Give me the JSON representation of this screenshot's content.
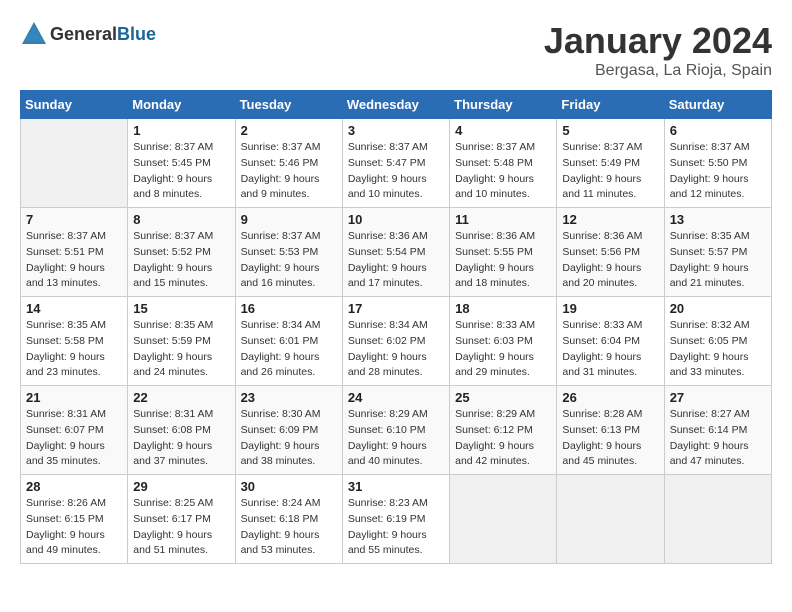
{
  "header": {
    "logo_general": "General",
    "logo_blue": "Blue",
    "title": "January 2024",
    "subtitle": "Bergasa, La Rioja, Spain"
  },
  "calendar": {
    "days_of_week": [
      "Sunday",
      "Monday",
      "Tuesday",
      "Wednesday",
      "Thursday",
      "Friday",
      "Saturday"
    ],
    "weeks": [
      [
        {
          "day": "",
          "detail": ""
        },
        {
          "day": "1",
          "detail": "Sunrise: 8:37 AM\nSunset: 5:45 PM\nDaylight: 9 hours\nand 8 minutes."
        },
        {
          "day": "2",
          "detail": "Sunrise: 8:37 AM\nSunset: 5:46 PM\nDaylight: 9 hours\nand 9 minutes."
        },
        {
          "day": "3",
          "detail": "Sunrise: 8:37 AM\nSunset: 5:47 PM\nDaylight: 9 hours\nand 10 minutes."
        },
        {
          "day": "4",
          "detail": "Sunrise: 8:37 AM\nSunset: 5:48 PM\nDaylight: 9 hours\nand 10 minutes."
        },
        {
          "day": "5",
          "detail": "Sunrise: 8:37 AM\nSunset: 5:49 PM\nDaylight: 9 hours\nand 11 minutes."
        },
        {
          "day": "6",
          "detail": "Sunrise: 8:37 AM\nSunset: 5:50 PM\nDaylight: 9 hours\nand 12 minutes."
        }
      ],
      [
        {
          "day": "7",
          "detail": "Sunrise: 8:37 AM\nSunset: 5:51 PM\nDaylight: 9 hours\nand 13 minutes."
        },
        {
          "day": "8",
          "detail": "Sunrise: 8:37 AM\nSunset: 5:52 PM\nDaylight: 9 hours\nand 15 minutes."
        },
        {
          "day": "9",
          "detail": "Sunrise: 8:37 AM\nSunset: 5:53 PM\nDaylight: 9 hours\nand 16 minutes."
        },
        {
          "day": "10",
          "detail": "Sunrise: 8:36 AM\nSunset: 5:54 PM\nDaylight: 9 hours\nand 17 minutes."
        },
        {
          "day": "11",
          "detail": "Sunrise: 8:36 AM\nSunset: 5:55 PM\nDaylight: 9 hours\nand 18 minutes."
        },
        {
          "day": "12",
          "detail": "Sunrise: 8:36 AM\nSunset: 5:56 PM\nDaylight: 9 hours\nand 20 minutes."
        },
        {
          "day": "13",
          "detail": "Sunrise: 8:35 AM\nSunset: 5:57 PM\nDaylight: 9 hours\nand 21 minutes."
        }
      ],
      [
        {
          "day": "14",
          "detail": "Sunrise: 8:35 AM\nSunset: 5:58 PM\nDaylight: 9 hours\nand 23 minutes."
        },
        {
          "day": "15",
          "detail": "Sunrise: 8:35 AM\nSunset: 5:59 PM\nDaylight: 9 hours\nand 24 minutes."
        },
        {
          "day": "16",
          "detail": "Sunrise: 8:34 AM\nSunset: 6:01 PM\nDaylight: 9 hours\nand 26 minutes."
        },
        {
          "day": "17",
          "detail": "Sunrise: 8:34 AM\nSunset: 6:02 PM\nDaylight: 9 hours\nand 28 minutes."
        },
        {
          "day": "18",
          "detail": "Sunrise: 8:33 AM\nSunset: 6:03 PM\nDaylight: 9 hours\nand 29 minutes."
        },
        {
          "day": "19",
          "detail": "Sunrise: 8:33 AM\nSunset: 6:04 PM\nDaylight: 9 hours\nand 31 minutes."
        },
        {
          "day": "20",
          "detail": "Sunrise: 8:32 AM\nSunset: 6:05 PM\nDaylight: 9 hours\nand 33 minutes."
        }
      ],
      [
        {
          "day": "21",
          "detail": "Sunrise: 8:31 AM\nSunset: 6:07 PM\nDaylight: 9 hours\nand 35 minutes."
        },
        {
          "day": "22",
          "detail": "Sunrise: 8:31 AM\nSunset: 6:08 PM\nDaylight: 9 hours\nand 37 minutes."
        },
        {
          "day": "23",
          "detail": "Sunrise: 8:30 AM\nSunset: 6:09 PM\nDaylight: 9 hours\nand 38 minutes."
        },
        {
          "day": "24",
          "detail": "Sunrise: 8:29 AM\nSunset: 6:10 PM\nDaylight: 9 hours\nand 40 minutes."
        },
        {
          "day": "25",
          "detail": "Sunrise: 8:29 AM\nSunset: 6:12 PM\nDaylight: 9 hours\nand 42 minutes."
        },
        {
          "day": "26",
          "detail": "Sunrise: 8:28 AM\nSunset: 6:13 PM\nDaylight: 9 hours\nand 45 minutes."
        },
        {
          "day": "27",
          "detail": "Sunrise: 8:27 AM\nSunset: 6:14 PM\nDaylight: 9 hours\nand 47 minutes."
        }
      ],
      [
        {
          "day": "28",
          "detail": "Sunrise: 8:26 AM\nSunset: 6:15 PM\nDaylight: 9 hours\nand 49 minutes."
        },
        {
          "day": "29",
          "detail": "Sunrise: 8:25 AM\nSunset: 6:17 PM\nDaylight: 9 hours\nand 51 minutes."
        },
        {
          "day": "30",
          "detail": "Sunrise: 8:24 AM\nSunset: 6:18 PM\nDaylight: 9 hours\nand 53 minutes."
        },
        {
          "day": "31",
          "detail": "Sunrise: 8:23 AM\nSunset: 6:19 PM\nDaylight: 9 hours\nand 55 minutes."
        },
        {
          "day": "",
          "detail": ""
        },
        {
          "day": "",
          "detail": ""
        },
        {
          "day": "",
          "detail": ""
        }
      ]
    ]
  }
}
